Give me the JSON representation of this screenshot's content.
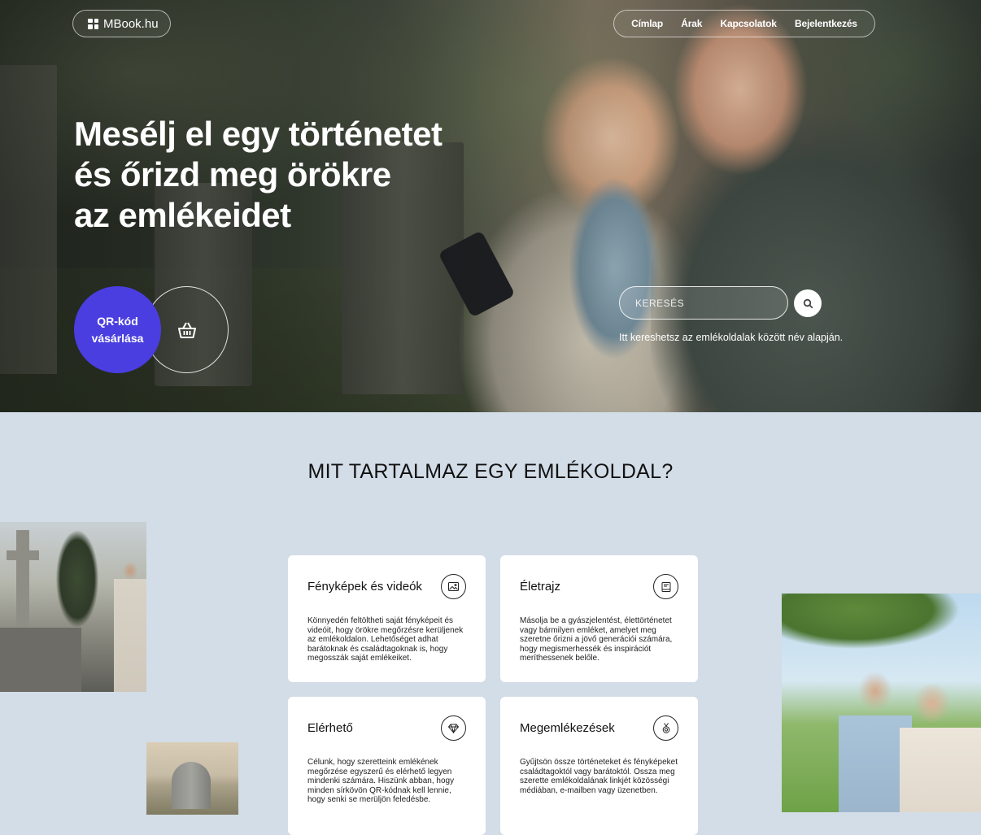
{
  "brand": {
    "name": "MBook.hu"
  },
  "nav": {
    "items": [
      "Címlap",
      "Árak",
      "Kapcsolatok",
      "Bejelentkezés"
    ]
  },
  "hero": {
    "headline_lines": [
      "Mesélj el egy történetet",
      "és őrizd meg örökre",
      "az emlékeidet"
    ],
    "qr_button_label": "QR-kód vásárlása",
    "search": {
      "placeholder": "KERESÉS",
      "help_text": "Itt kereshetsz az emlékoldalak között név alapján."
    }
  },
  "features": {
    "title": "MIT TARTALMAZ EGY EMLÉKOLDAL?",
    "cards": [
      {
        "title": "Fényképek és videók",
        "icon": "image-icon",
        "text": "Könnyedén feltöltheti saját fényképeit és videóit, hogy örökre megőrzésre kerüljenek az emlékoldalon. Lehetőséget adhat barátoknak és családtagoknak is, hogy megosszák saját emlékeiket."
      },
      {
        "title": "Életrajz",
        "icon": "book-icon",
        "text": "Másolja be a gyászjelentést, élettörténetet vagy bármilyen emléket, amelyet meg szeretne őrizni a jövő generációi számára, hogy megismerhessék és inspirációt meríthessenek belőle."
      },
      {
        "title": "Elérhető",
        "icon": "diamond-icon",
        "text": "Célunk, hogy szeretteink emlékének megőrzése egyszerű és elérhető legyen mindenki számára. Hiszünk abban, hogy minden sírkövön QR-kódnak kell lennie, hogy senki se merüljön feledésbe."
      },
      {
        "title": "Megemlékezések",
        "icon": "medal-icon",
        "text": "Gyűjtsön össze történeteket és fényképeket családtagoktól vagy barátoktól. Ossza meg szerette emlékoldalának linkjét közösségi médiában, e-mailben vagy üzenetben."
      }
    ]
  },
  "colors": {
    "accent": "#4a3ee0",
    "section_bg": "#d3dde7",
    "card_bg": "#ffffff"
  }
}
